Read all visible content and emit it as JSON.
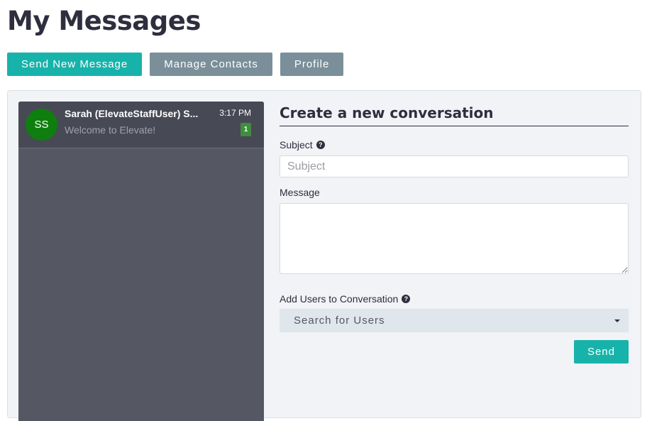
{
  "page": {
    "title": "My Messages"
  },
  "toolbar": {
    "send_new_message": "Send New Message",
    "manage_contacts": "Manage Contacts",
    "profile": "Profile"
  },
  "conversations": [
    {
      "initials": "SS",
      "name": "Sarah (ElevateStaffUser) S...",
      "time": "3:17 PM",
      "preview": "Welcome to Elevate!",
      "unread": "1",
      "avatar_color": "#0e7f0e"
    }
  ],
  "form": {
    "heading": "Create a new conversation",
    "subject_label": "Subject",
    "subject_placeholder": "Subject",
    "message_label": "Message",
    "users_label": "Add Users to Conversation",
    "users_placeholder": "Search for Users",
    "send_label": "Send"
  },
  "icons": {
    "help": "question-circle-icon",
    "dropdown": "caret-down-icon"
  },
  "colors": {
    "accent": "#17b3aa",
    "secondary": "#7a8f99",
    "sidebar": "#555763",
    "badge": "#3e8e3e"
  }
}
